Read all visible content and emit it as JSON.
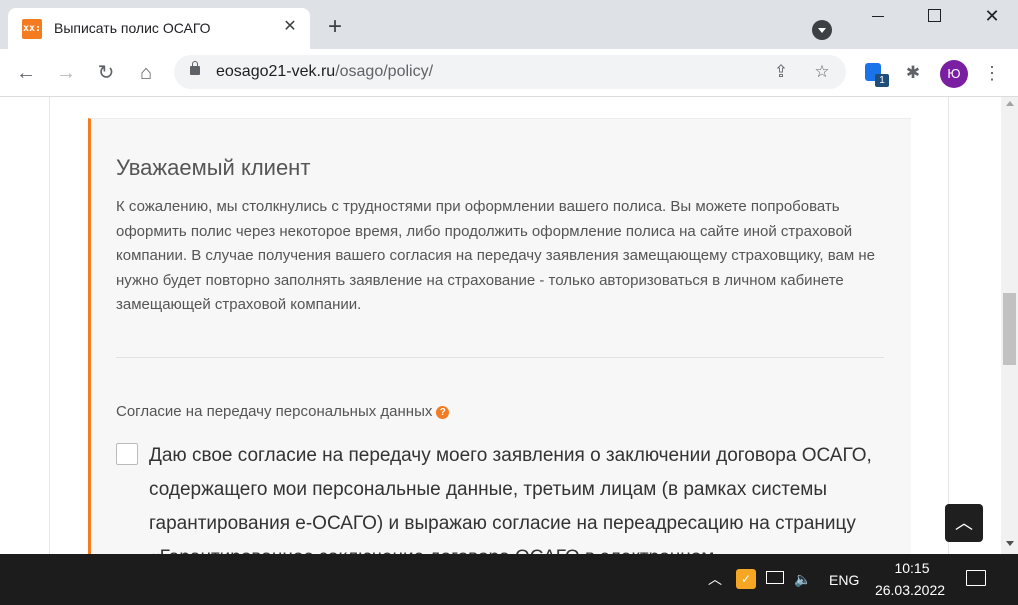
{
  "browser": {
    "tab": {
      "favicon_text": "xx:",
      "title": "Выписать полис ОСАГО"
    },
    "new_tab_symbol": "+",
    "url": {
      "host": "eosago21-vek.ru",
      "path": "/osago/policy/"
    },
    "extension_badge": "1",
    "profile_initial": "Ю"
  },
  "notice": {
    "title": "Уважаемый клиент",
    "text": "К сожалению, мы столкнулись с трудностями при оформлении вашего полиса. Вы можете попробовать оформить полис через некоторое время, либо продолжить оформление полиса на сайте иной страховой компании. В случае получения вашего согласия на передачу заявления замещающему страховщику, вам не нужно будет повторно заполнять заявление на страхование - только авторизоваться в личном кабинете замещающей страховой компании."
  },
  "consent": {
    "label": "Согласие на передачу персональных данных",
    "help_symbol": "?",
    "checked": false,
    "text": "Даю свое согласие на передачу моего заявления о заключении договора ОСАГО, содержащего мои персональные данные, третьим лицам (в рамках системы гарантирования е-ОСАГО) и выражаю согласие на переадресацию на страницу «Гарантированное заключение договора ОСАГО в электронном"
  },
  "taskbar": {
    "language": "ENG",
    "time": "10:15",
    "date": "26.03.2022"
  },
  "colors": {
    "accent": "#f47b20",
    "profile": "#7b1fa2"
  },
  "icons": [
    "lock-icon",
    "share-icon",
    "star-icon",
    "extension-icon",
    "puzzle-icon",
    "kebab-menu-icon",
    "back-icon",
    "forward-icon",
    "reload-icon",
    "home-icon",
    "help-icon",
    "chevron-up-icon"
  ]
}
